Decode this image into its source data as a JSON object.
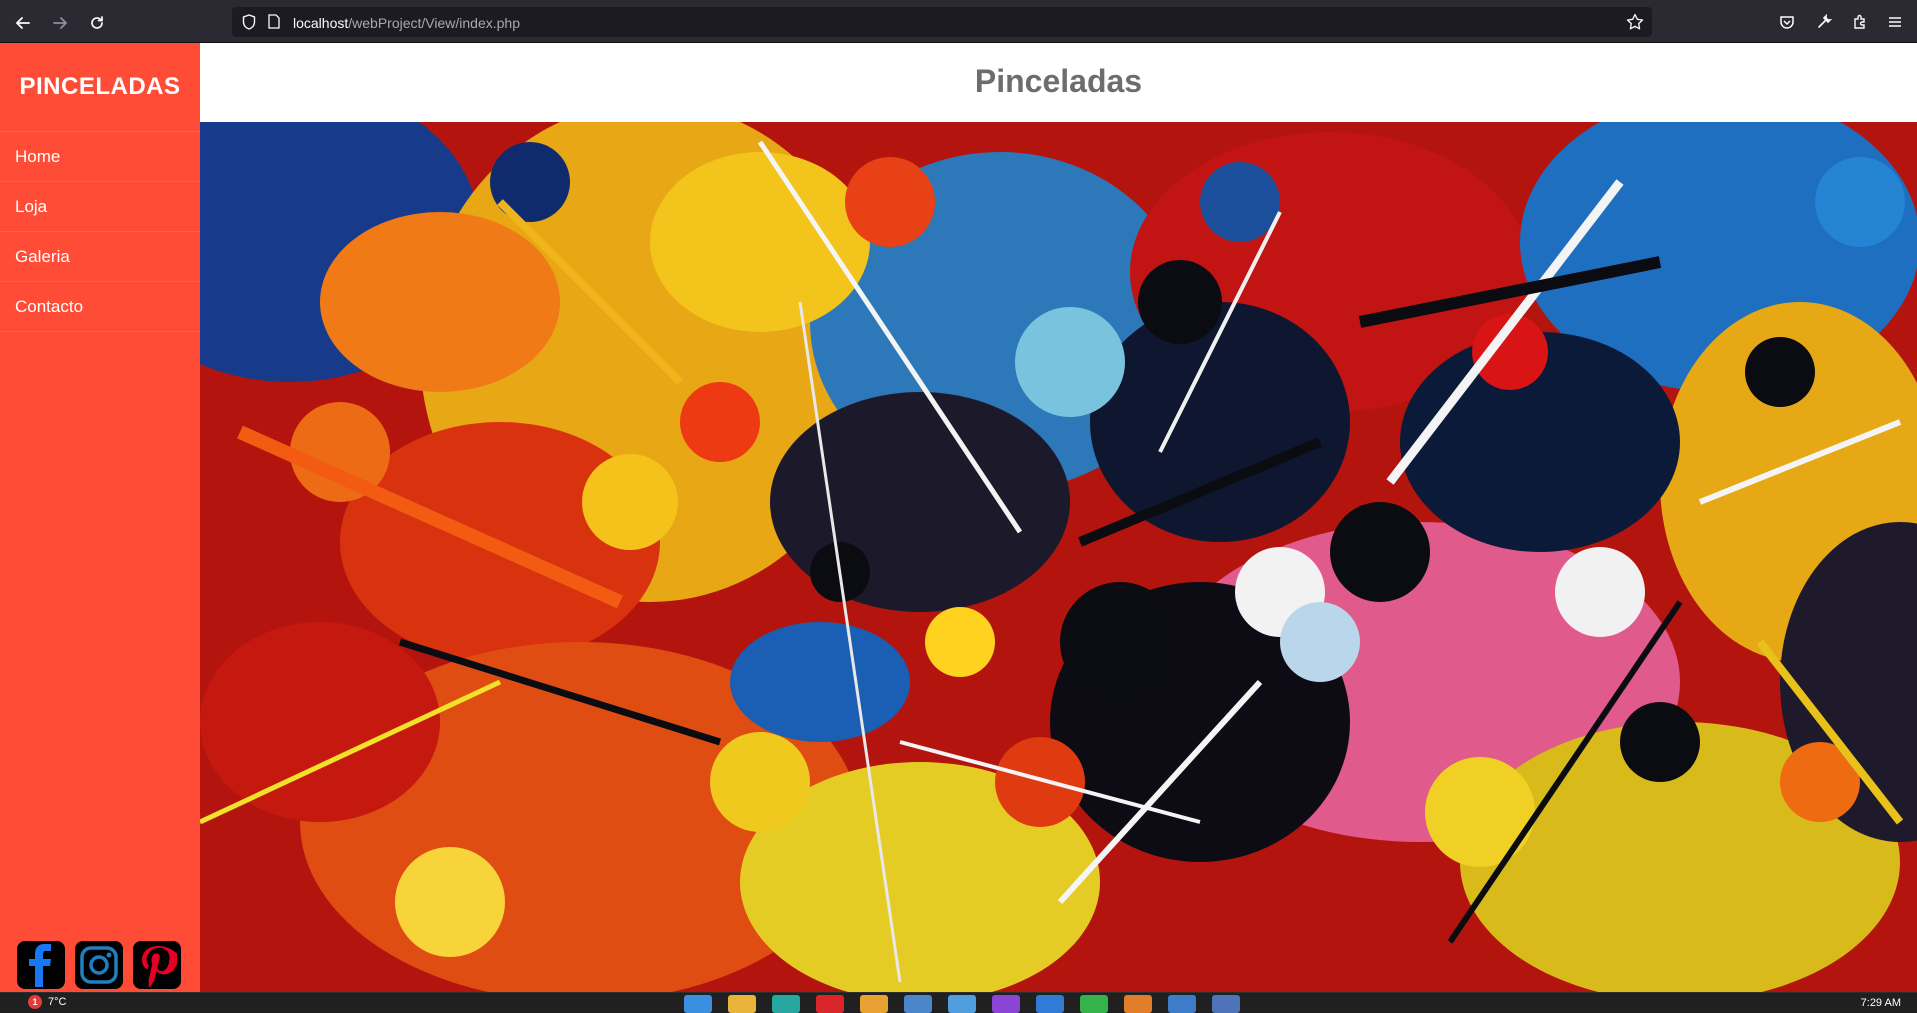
{
  "browser": {
    "url_host": "localhost",
    "url_path": "/webProject/View/index.php"
  },
  "sidebar": {
    "brand": "PINCELADAS",
    "menu": [
      {
        "label": "Home"
      },
      {
        "label": "Loja"
      },
      {
        "label": "Galeria"
      },
      {
        "label": "Contacto"
      }
    ],
    "socials": [
      "facebook-icon",
      "instagram-icon",
      "pinterest-icon"
    ]
  },
  "main": {
    "title": "Pinceladas",
    "hero_image": "abstract-paint-splatter-image"
  },
  "taskbar": {
    "notification_count": "1",
    "temperature": "7°C",
    "time": "7:29 AM"
  },
  "colors": {
    "sidebar": "#ff4c37",
    "title": "#6d6d6d",
    "browser_chrome": "#2b2a33"
  }
}
